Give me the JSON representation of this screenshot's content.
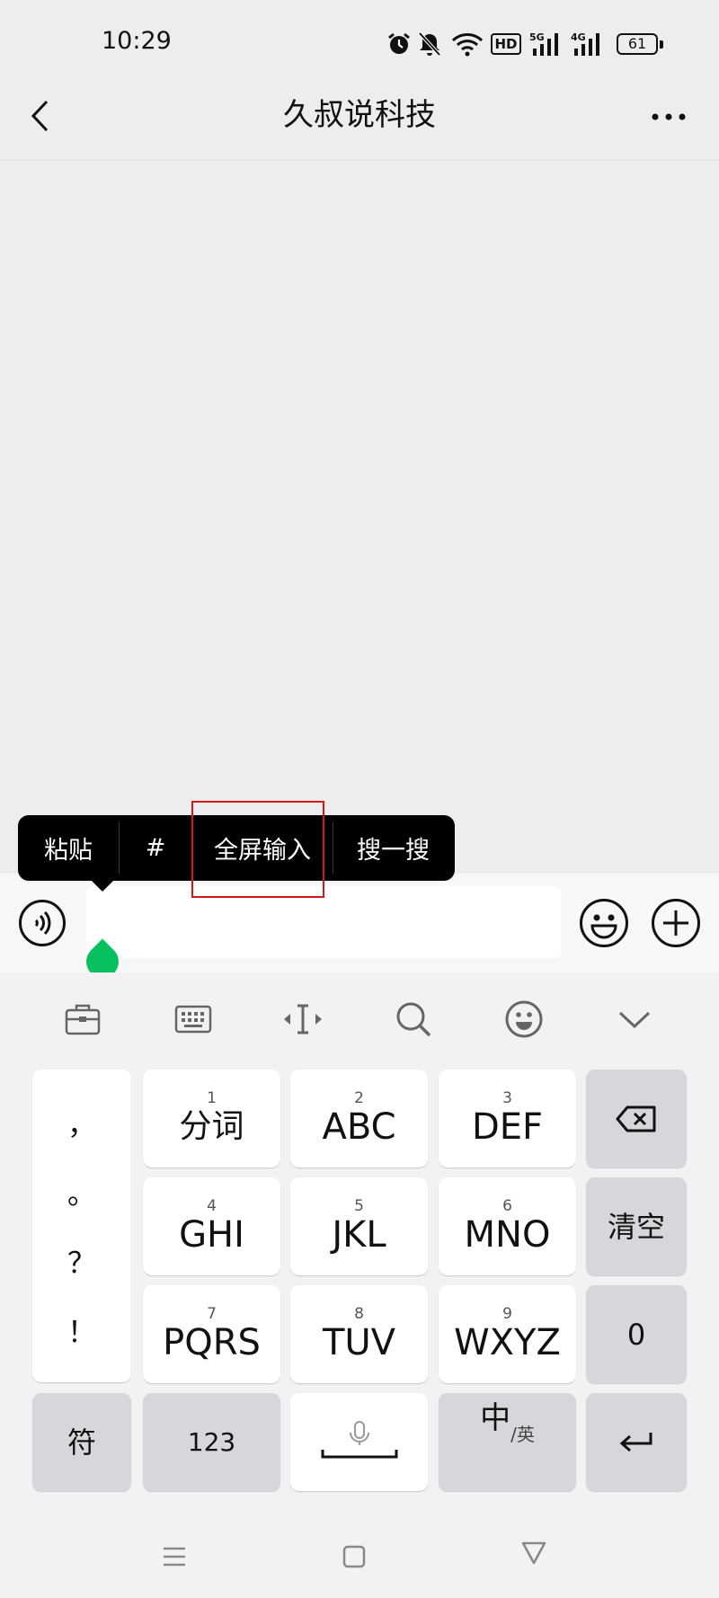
{
  "status_bar": {
    "time": "10:29",
    "hd_label": "HD",
    "signal1_label": "5G",
    "signal2_label": "4G",
    "battery": "61"
  },
  "header": {
    "back_icon": "chevron-left-icon",
    "title": "久叔说科技",
    "more_icon": "more-icon"
  },
  "context_menu": {
    "items": [
      "粘贴",
      "#",
      "全屏输入",
      "搜一搜"
    ],
    "highlighted": "全屏输入"
  },
  "input_bar": {
    "voice_icon": "voice-icon",
    "text_value": "",
    "emoji_icon": "emoji-icon",
    "plus_icon": "plus-icon"
  },
  "keyboard": {
    "toolbar": [
      "toolbox-icon",
      "keyboard-icon",
      "cursor-icon",
      "search-icon",
      "emoji-icon",
      "collapse-icon"
    ],
    "punctuation": [
      "，",
      "。",
      "？",
      "！"
    ],
    "keys": [
      {
        "num": "1",
        "label": "分词"
      },
      {
        "num": "2",
        "label": "ABC"
      },
      {
        "num": "3",
        "label": "DEF"
      },
      {
        "num": "4",
        "label": "GHI"
      },
      {
        "num": "5",
        "label": "JKL"
      },
      {
        "num": "6",
        "label": "MNO"
      },
      {
        "num": "7",
        "label": "PQRS"
      },
      {
        "num": "8",
        "label": "TUV"
      },
      {
        "num": "9",
        "label": "WXYZ"
      }
    ],
    "clear_label": "清空",
    "zero_label": "0",
    "symbol_label": "符",
    "numbers_label": "123",
    "lang_main": "中",
    "lang_sub": "/英",
    "backspace_icon": "backspace-icon",
    "enter_icon": "enter-icon",
    "space_icon": "space-microphone-icon"
  },
  "nav_bar": [
    "menu-icon",
    "home-icon",
    "back-triangle-icon"
  ]
}
